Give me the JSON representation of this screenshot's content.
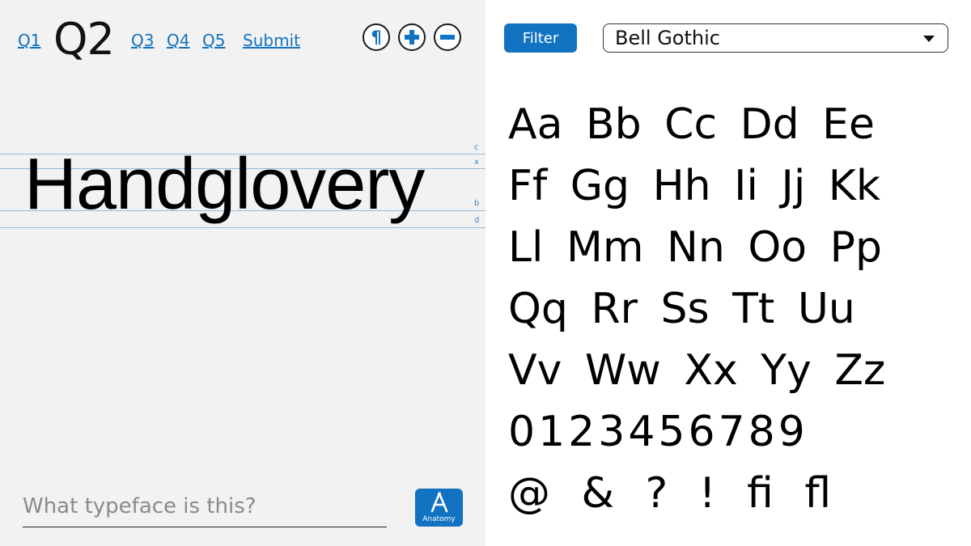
{
  "question_nav": {
    "items": [
      {
        "label": "Q1",
        "current": false
      },
      {
        "label": "Q2",
        "current": true
      },
      {
        "label": "Q3",
        "current": false
      },
      {
        "label": "Q4",
        "current": false
      },
      {
        "label": "Q5",
        "current": false
      }
    ],
    "submit_label": "Submit"
  },
  "controls": {
    "pilcrow_symbol": "¶",
    "zoom_in_icon": "plus-icon",
    "zoom_out_icon": "minus-icon"
  },
  "specimen": {
    "text": "Handglovery",
    "guides": [
      "c",
      "x",
      "b",
      "d"
    ]
  },
  "answer": {
    "placeholder": "What typeface is this?",
    "value": ""
  },
  "anatomy_button": {
    "label": "Anatomy",
    "icon": "anatomy-a-icon"
  },
  "filter": {
    "label": "Filter"
  },
  "font_select": {
    "selected": "Bell Gothic"
  },
  "glyphs": {
    "rows": [
      "Aa Bb Cc Dd Ee",
      "Ff Gg Hh Ii Jj Kk",
      "Ll Mm Nn Oo Pp",
      "Qq Rr Ss Tt Uu",
      "Vv Ww Xx Yy Zz",
      "0123456789",
      "@ & ? ! ﬁ ﬂ"
    ]
  },
  "colors": {
    "accent": "#1173c1",
    "guide_line": "#8fbde0",
    "panel_bg": "#f2f2f2"
  }
}
